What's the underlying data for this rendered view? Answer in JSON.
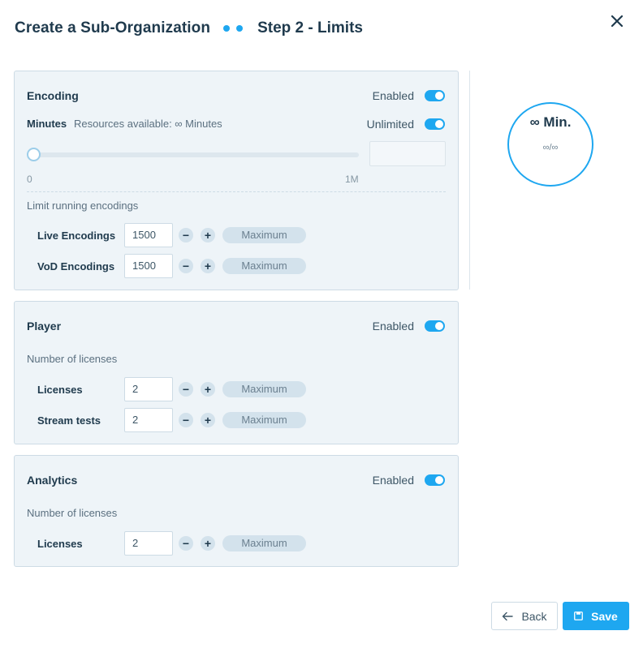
{
  "header": {
    "title": "Create a Sub-Organization",
    "step": "Step 2 - Limits"
  },
  "encoding": {
    "title": "Encoding",
    "enabled_label": "Enabled",
    "minutes_label": "Minutes",
    "resources_text": "Resources available: ∞ Minutes",
    "unlimited_label": "Unlimited",
    "slider_min": "0",
    "slider_max": "1M",
    "slider_value_fraction": 0,
    "limit_heading": "Limit running encodings",
    "rows": [
      {
        "label": "Live Encodings",
        "value": "1500",
        "max_label": "Maximum"
      },
      {
        "label": "VoD Encodings",
        "value": "1500",
        "max_label": "Maximum"
      }
    ]
  },
  "player": {
    "title": "Player",
    "enabled_label": "Enabled",
    "licenses_heading": "Number of licenses",
    "rows": [
      {
        "label": "Licenses",
        "value": "2",
        "max_label": "Maximum"
      },
      {
        "label": "Stream tests",
        "value": "2",
        "max_label": "Maximum"
      }
    ]
  },
  "analytics": {
    "title": "Analytics",
    "enabled_label": "Enabled",
    "licenses_heading": "Number of licenses",
    "rows": [
      {
        "label": "Licenses",
        "value": "2",
        "max_label": "Maximum"
      }
    ]
  },
  "summary": {
    "big": "∞ Min.",
    "small": "∞/∞"
  },
  "stepper": {
    "minus": "−",
    "plus": "+"
  },
  "footer": {
    "back_label": "Back",
    "save_label": "Save"
  },
  "colors": {
    "accent": "#1ea7f0",
    "panel_bg": "#eef4f8",
    "text_dark": "#1f3a4d"
  },
  "icons": {
    "close": "close-icon",
    "back": "arrow-left-icon",
    "save": "floppy-disk-icon"
  }
}
